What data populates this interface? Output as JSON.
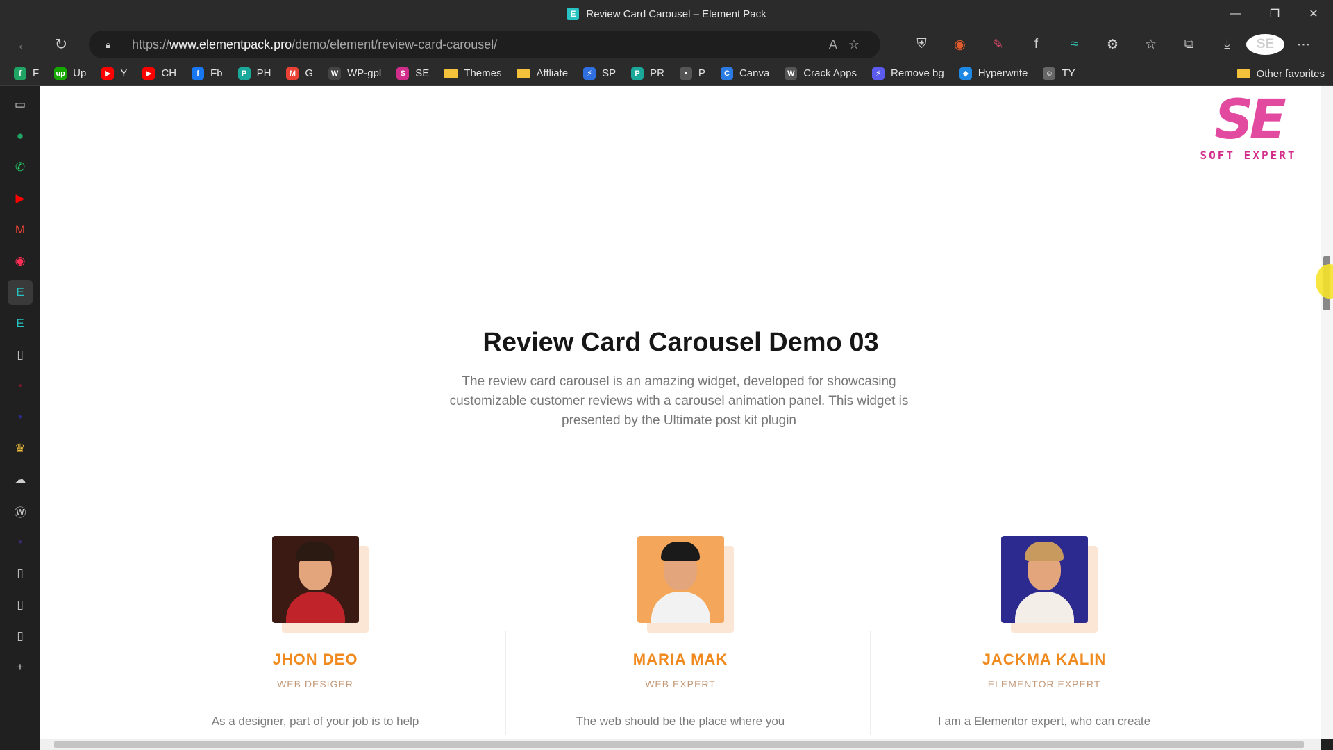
{
  "window": {
    "title": "Review Card Carousel – Element Pack",
    "controls": [
      "—",
      "❐",
      "✕"
    ]
  },
  "address": {
    "scheme": "https://",
    "host": "www.elementpack.pro",
    "path": "/demo/element/review-card-carousel/"
  },
  "bookmarks": [
    {
      "label": "F",
      "icon": "f",
      "color": "#1fa463"
    },
    {
      "label": "Up",
      "icon": "up",
      "color": "#14a800"
    },
    {
      "label": "Y",
      "icon": "▶",
      "color": "#ff0000"
    },
    {
      "label": "CH",
      "icon": "▶",
      "color": "#ff0000"
    },
    {
      "label": "Fb",
      "icon": "f",
      "color": "#1877f2"
    },
    {
      "label": "PH",
      "icon": "P",
      "color": "#1aa89a"
    },
    {
      "label": "G",
      "icon": "M",
      "color": "#ea4335"
    },
    {
      "label": "WP-gpl",
      "icon": "W",
      "color": "#444444"
    },
    {
      "label": "SE",
      "icon": "S",
      "color": "#d12d8b"
    },
    {
      "label": "Themes",
      "icon": "folder",
      "color": "#f3c13a"
    },
    {
      "label": "Affliate",
      "icon": "folder",
      "color": "#f3c13a"
    },
    {
      "label": "SP",
      "icon": "⚡",
      "color": "#2f6fe0"
    },
    {
      "label": "PR",
      "icon": "P",
      "color": "#1aa89a"
    },
    {
      "label": "P",
      "icon": "•",
      "color": "#555555"
    },
    {
      "label": "Canva",
      "icon": "C",
      "color": "#2b7be4"
    },
    {
      "label": "Crack Apps",
      "icon": "W",
      "color": "#555555"
    },
    {
      "label": "Remove bg",
      "icon": "⚡",
      "color": "#5b5bf0"
    },
    {
      "label": "Hyperwrite",
      "icon": "◆",
      "color": "#1e88e5"
    },
    {
      "label": "TY",
      "icon": "☺",
      "color": "#666666"
    }
  ],
  "other_favorites": "Other favorites",
  "logo": {
    "mark": "SE",
    "word": "SOFT EXPERT"
  },
  "section": {
    "title": "Review Card Carousel Demo 03",
    "description": "The review card carousel is an amazing widget, developed for showcasing customizable customer reviews with a carousel animation panel. This widget is presented by the Ultimate post kit plugin"
  },
  "cards": [
    {
      "name": "JHON DEO",
      "role": "WEB DESIGER",
      "quote": "As a designer, part of your job is to help",
      "bg": "#3b1a14",
      "shirt": "#c0242a",
      "hair": "#2b1a12"
    },
    {
      "name": "MARIA MAK",
      "role": "WEB EXPERT",
      "quote": "The web should be the place where you",
      "bg": "#f4a65a",
      "shirt": "#f2f2f2",
      "hair": "#1a1a1a"
    },
    {
      "name": "JACKMA KALIN",
      "role": "ELEMENTOR EXPERT",
      "quote": "I am a Elementor expert, who can create",
      "bg": "#2c2a8f",
      "shirt": "#f3efe8",
      "hair": "#c89a5e"
    }
  ]
}
